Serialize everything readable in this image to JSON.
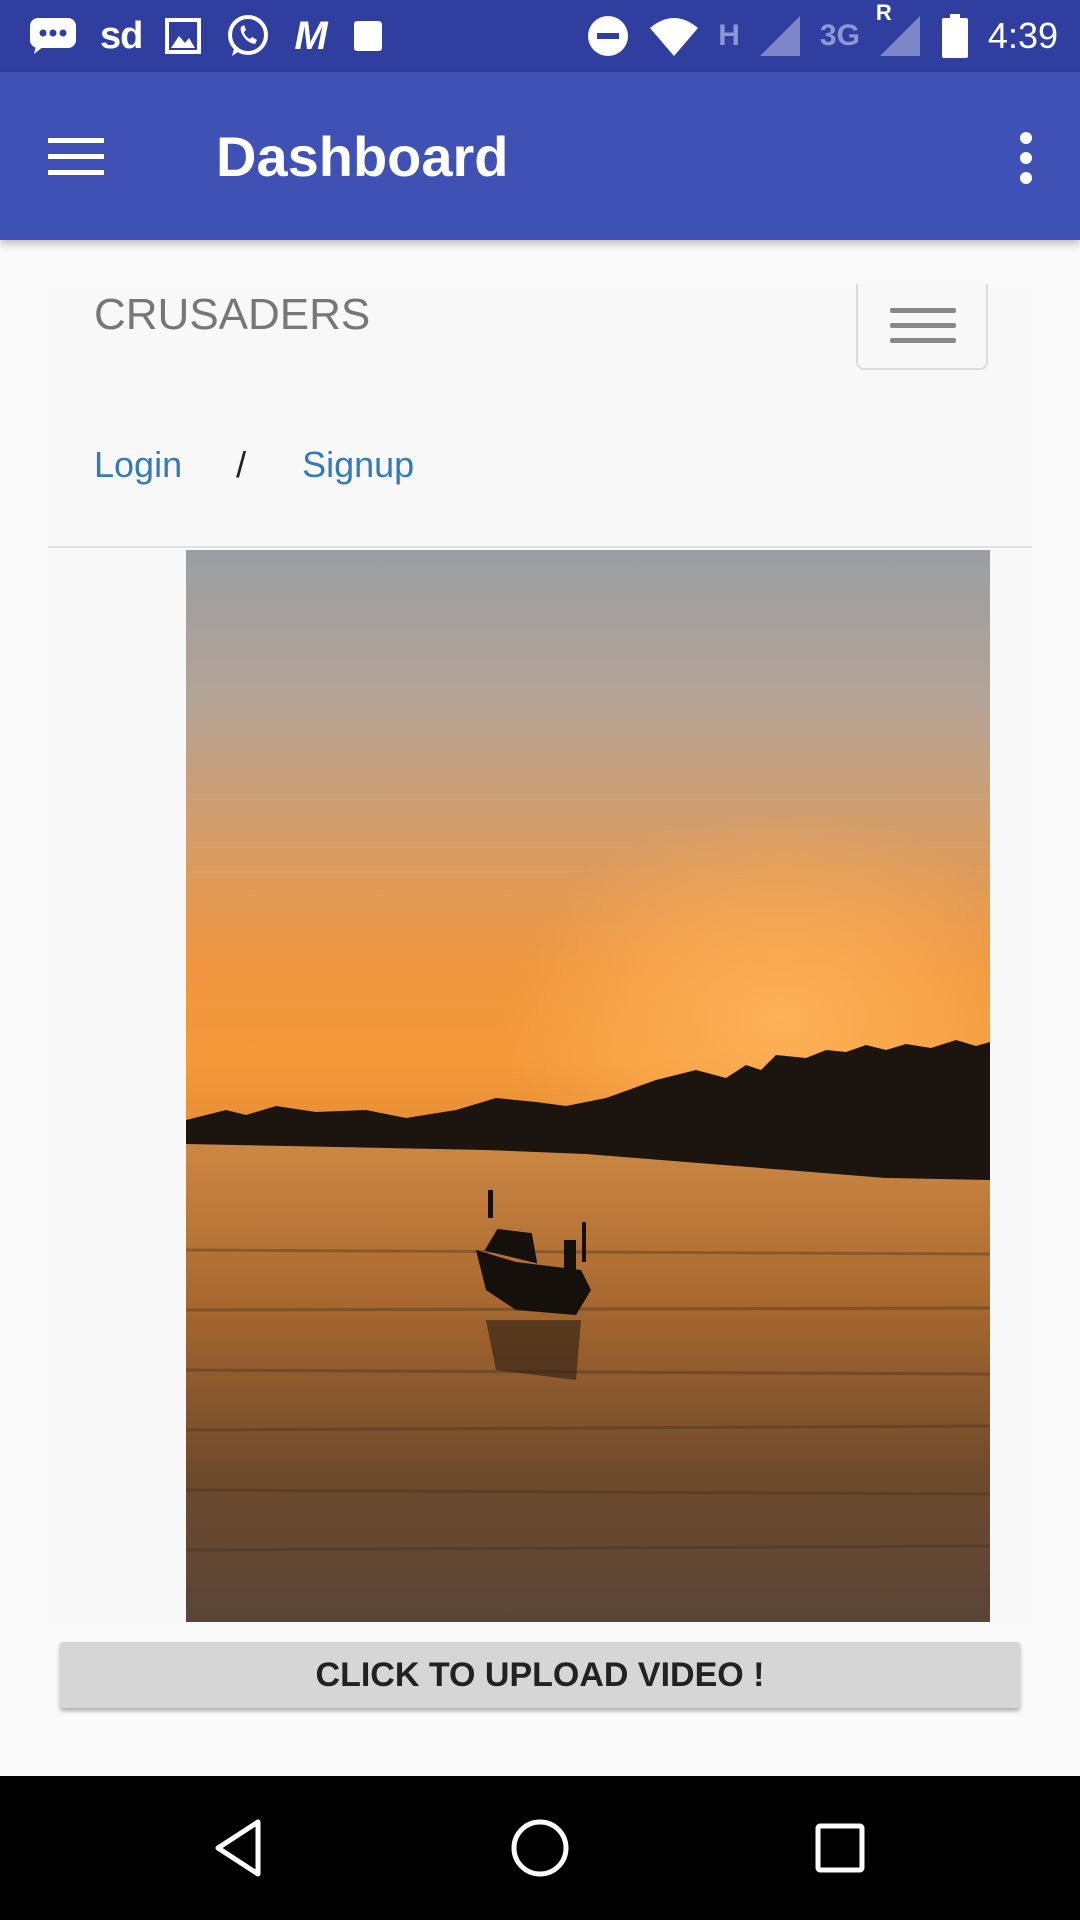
{
  "status_bar": {
    "left_icons": [
      "message-icon",
      "sd-icon",
      "gallery-icon",
      "whatsapp-icon",
      "m-icon",
      "note-icon"
    ],
    "sd_text": "sd",
    "m_text": "M",
    "network_h": "H",
    "network_3g": "3G",
    "roaming": "R",
    "time": "4:39"
  },
  "app_bar": {
    "title": "Dashboard",
    "color": "#3f51b5",
    "status_color": "#303f9f"
  },
  "web": {
    "brand": "CRUSADERS",
    "login_label": "Login",
    "separator": "/",
    "signup_label": "Signup",
    "link_color": "#337ab7"
  },
  "upload_button": {
    "label": "CLICK TO UPLOAD VIDEO !"
  },
  "nav_bar": {
    "icons": [
      "back-icon",
      "home-icon",
      "recents-icon"
    ]
  }
}
